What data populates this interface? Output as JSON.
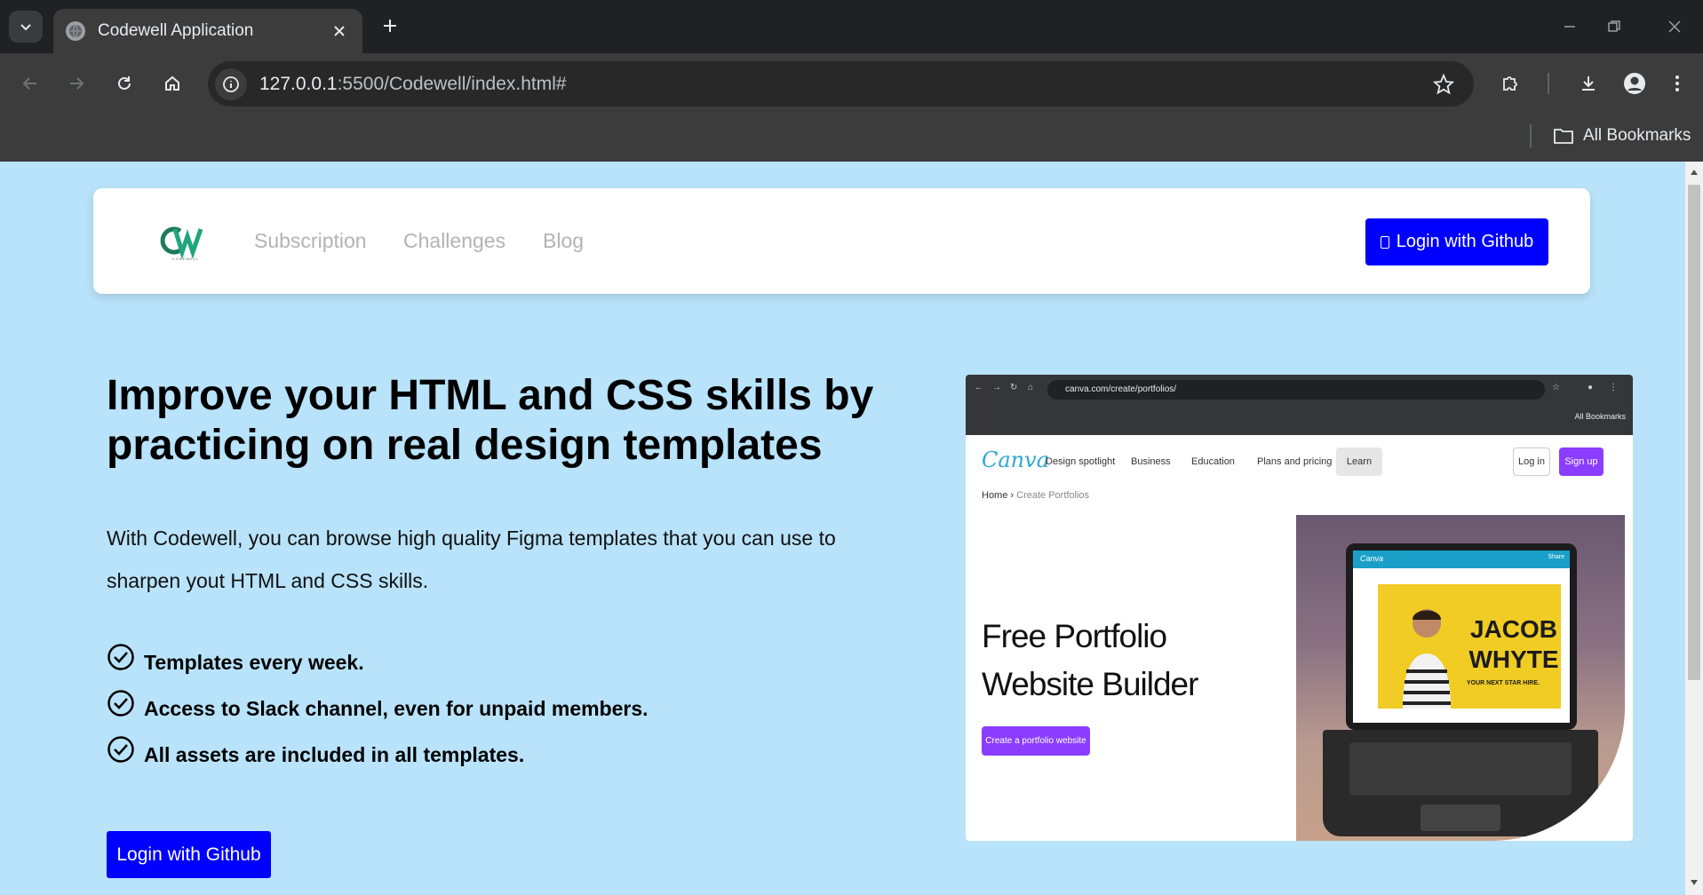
{
  "browser": {
    "tab_title": "Codewell Application",
    "url_host": "127.0.0.1",
    "url_path": ":5500/Codewell/index.html#",
    "bookmarks_label": "All Bookmarks"
  },
  "navbar": {
    "logo_text": "CW",
    "logo_subtext": "CODEWELL",
    "links": [
      "Subscription",
      "Challenges",
      "Blog"
    ],
    "login_label": "Login with Github"
  },
  "hero": {
    "title": "Improve your HTML and CSS skills by practicing on real design templates",
    "description": "With Codewell, you can browse high quality Figma templates that you can use to sharpen yout HTML and CSS skills.",
    "features": [
      "Templates every week.",
      "Access to Slack channel, even for unpaid members.",
      "All assets are included in all templates."
    ],
    "cta_label": "Login with Github"
  },
  "preview": {
    "url": "canva.com/create/portfolios/",
    "bookmarks": "All Bookmarks",
    "logo": "Canva",
    "nav": [
      "Design spotlight",
      "Business",
      "Education",
      "Plans and pricing"
    ],
    "learn": "Learn",
    "login": "Log in",
    "signup": "Sign up",
    "crumb_home": "Home",
    "crumb_current": "Create Portfolios",
    "headline": "Free Portfolio Website Builder",
    "cta": "Create a portfolio website",
    "mini_app_name": "Canva",
    "mini_share": "Share",
    "poster_name": "JACOB WHYTE",
    "poster_tagline": "YOUR NEXT STAR HIRE."
  },
  "colors": {
    "page_bg": "#b8e3fa",
    "primary_button": "#0000ff",
    "nav_link": "#b3b3b3",
    "canva_purple": "#8b3dff"
  }
}
